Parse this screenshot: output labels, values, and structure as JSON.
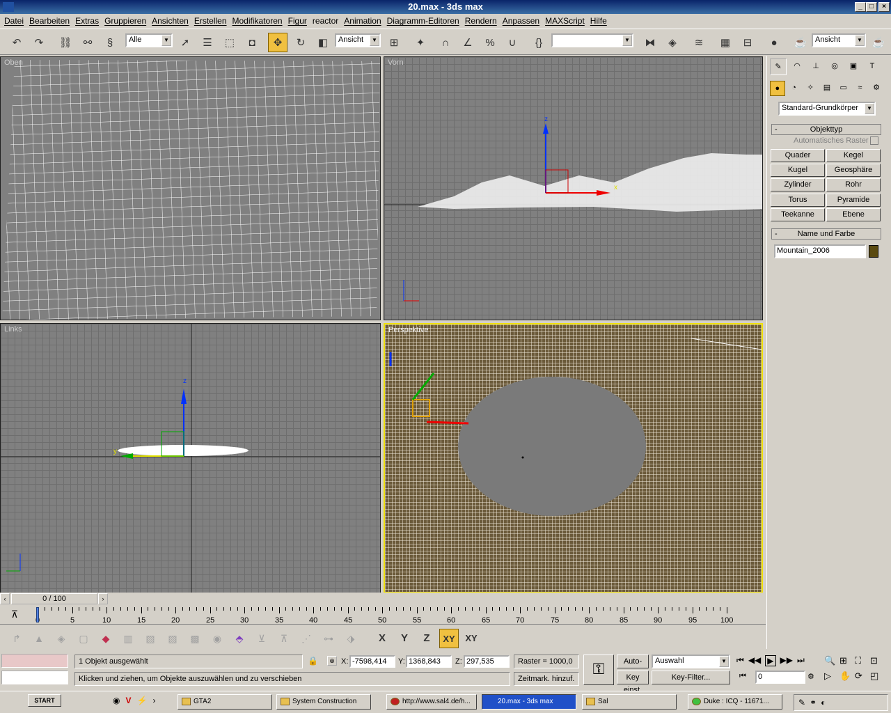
{
  "window": {
    "title": "20.max - 3ds max"
  },
  "menu": [
    "Datei",
    "Bearbeiten",
    "Extras",
    "Gruppieren",
    "Ansichten",
    "Erstellen",
    "Modifikatoren",
    "Figur",
    "reactor",
    "Animation",
    "Diagramm-Editoren",
    "Rendern",
    "Anpassen",
    "MAXScript",
    "Hilfe"
  ],
  "toolbar": {
    "selection_filter": "Alle",
    "ref_coord": "Ansicht",
    "named_selection": "",
    "render_type": "Ansicht"
  },
  "viewports": {
    "top": "Oben",
    "front": "Vorn",
    "left": "Links",
    "perspective": "Perspektive"
  },
  "axis_labels": {
    "x": "x",
    "y": "y",
    "z": "z"
  },
  "command_panel": {
    "category": "Standard-Grundkörper",
    "rollout_objecttype": "Objekttyp",
    "auto_grid": "Automatisches Raster",
    "buttons": [
      "Quader",
      "Kegel",
      "Kugel",
      "Geosphäre",
      "Zylinder",
      "Rohr",
      "Torus",
      "Pyramide",
      "Teekanne",
      "Ebene"
    ],
    "rollout_namecolor": "Name und Farbe",
    "object_name": "Mountain_2006",
    "object_color": "#5a4a10"
  },
  "timeline": {
    "frame_display": "0 / 100",
    "current_frame_fraction": 0,
    "ticks": [
      "0",
      "5",
      "10",
      "15",
      "20",
      "25",
      "30",
      "35",
      "40",
      "45",
      "50",
      "55",
      "60",
      "65",
      "70",
      "75",
      "80",
      "85",
      "90",
      "95",
      "100"
    ]
  },
  "shelf": {
    "axes": [
      "X",
      "Y",
      "Z",
      "XY",
      "XY"
    ]
  },
  "status": {
    "selection": "1 Objekt ausgewählt",
    "prompt": "Klicken und ziehen, um Objekte auszuwählen und zu verschieben",
    "x_label": "X:",
    "x": "-7598,414",
    "y_label": "Y:",
    "y": "1368,843",
    "z_label": "Z:",
    "z": "297,535",
    "grid": "Raster = 1000,0",
    "time_tag": "Zeitmark. hinzuf.",
    "auto_key": "Auto-Key",
    "key_mode": "Auswahl",
    "set_key": "Key einst.",
    "key_filters": "Key-Filter...",
    "frame": "0"
  },
  "taskbar": {
    "start": "START",
    "tasks": [
      "GTA2",
      "System Construction",
      "http://www.sal4.de/h...",
      "20.max - 3ds max",
      "Sal",
      "Duke : ICQ - 11671..."
    ]
  }
}
